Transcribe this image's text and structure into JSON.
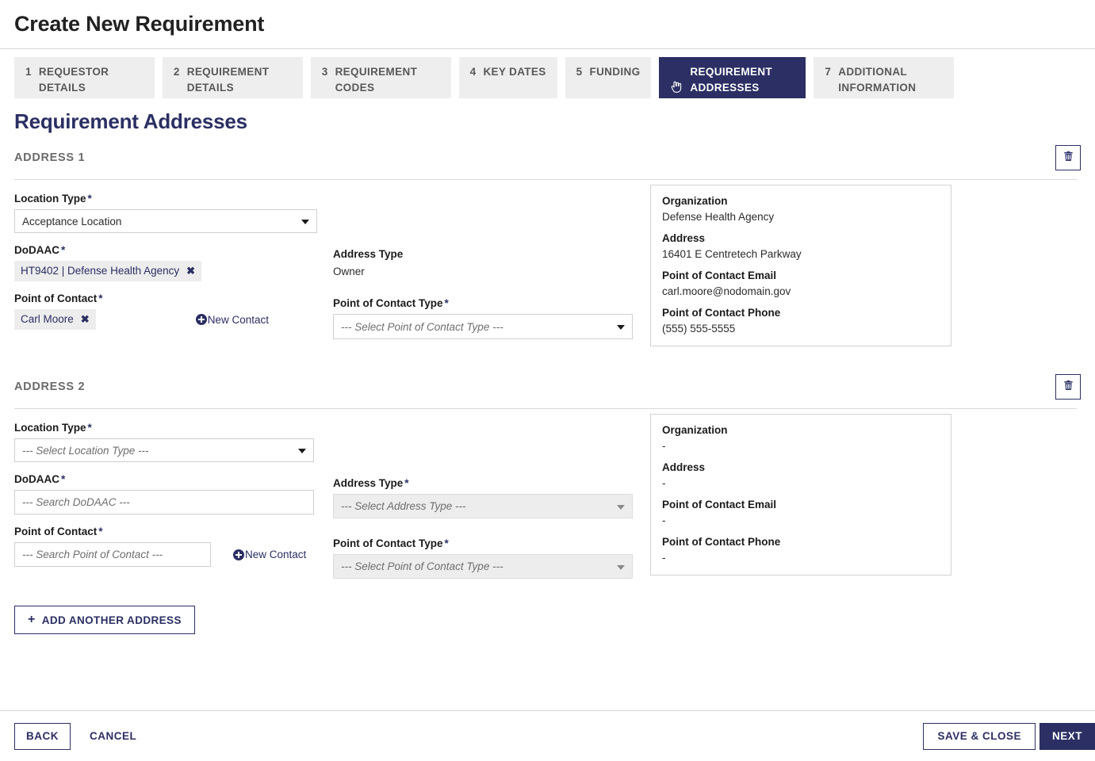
{
  "header": {
    "title": "Create New Requirement"
  },
  "stepper": [
    {
      "num": "1",
      "label": "REQUESTOR DETAILS",
      "active": false,
      "icon": null
    },
    {
      "num": "2",
      "label": "REQUIREMENT DETAILS",
      "active": false,
      "icon": null
    },
    {
      "num": "3",
      "label": "REQUIREMENT CODES",
      "active": false,
      "icon": null
    },
    {
      "num": "4",
      "label": "KEY DATES",
      "active": false,
      "icon": null
    },
    {
      "num": "5",
      "label": "FUNDING",
      "active": false,
      "icon": null
    },
    {
      "num": "",
      "label": "REQUIREMENT ADDRESSES",
      "active": true,
      "icon": "hand-pointer-icon"
    },
    {
      "num": "7",
      "label": "ADDITIONAL INFORMATION",
      "active": false,
      "icon": null
    }
  ],
  "section": {
    "title": "Requirement Addresses"
  },
  "labels": {
    "location_type": "Location Type",
    "dodaac": "DoDAAC",
    "point_of_contact": "Point of Contact",
    "address_type": "Address Type",
    "point_of_contact_type": "Point of Contact Type",
    "required_mark": "*",
    "new_contact": "New Contact",
    "organization": "Organization",
    "address": "Address",
    "poc_email": "Point of Contact Email",
    "poc_phone": "Point of Contact Phone"
  },
  "addresses": [
    {
      "heading": "ADDRESS 1",
      "location_type_value": "Acceptance Location",
      "dodaac_chip": "HT9402  |  Defense Health Agency",
      "poc_chip": "Carl Moore",
      "address_type_value": "Owner",
      "poc_type_placeholder": "--- Select Point of Contact Type ---",
      "info": {
        "organization": "Defense Health Agency",
        "address": "16401 E Centretech Parkway",
        "poc_email": "carl.moore@nodomain.gov",
        "poc_phone": "(555) 555-5555"
      }
    },
    {
      "heading": "ADDRESS 2",
      "location_type_placeholder": "--- Select Location Type ---",
      "dodaac_placeholder": "--- Search DoDAAC ---",
      "poc_placeholder": "--- Search Point of Contact ---",
      "address_type_placeholder": "--- Select Address Type ---",
      "poc_type_placeholder": "--- Select Point of Contact Type ---",
      "info": {
        "organization": "-",
        "address": "-",
        "poc_email": "-",
        "poc_phone": "-"
      }
    }
  ],
  "add_another_label": "ADD ANOTHER ADDRESS",
  "add_another_plus": "+",
  "footer": {
    "back": "BACK",
    "cancel": "CANCEL",
    "save_close": "SAVE & CLOSE",
    "next": "NEXT"
  },
  "icons": {
    "delete": "trash-icon",
    "chip_remove": "✖"
  },
  "colors": {
    "accent_navy": "#2b2f63",
    "tab_inactive": "#eeeeee",
    "chip_bg": "#ededed"
  }
}
